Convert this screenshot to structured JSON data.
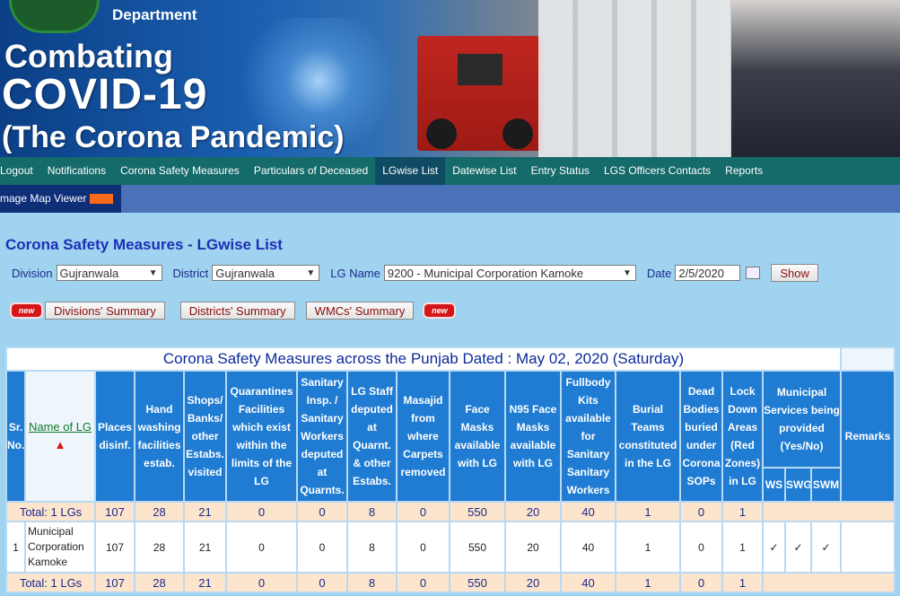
{
  "banner": {
    "department": "Department",
    "line1": "Combating",
    "line2": "COVID-19",
    "line3": "(The Corona Pandemic)"
  },
  "nav": {
    "items": [
      {
        "label": "Logout"
      },
      {
        "label": "Notifications"
      },
      {
        "label": "Corona Safety Measures"
      },
      {
        "label": "Particulars of Deceased"
      },
      {
        "label": "LGwise List"
      },
      {
        "label": "Datewise List"
      },
      {
        "label": "Entry Status"
      },
      {
        "label": "LGS Officers Contacts"
      },
      {
        "label": "Reports"
      }
    ],
    "active": "LGwise List",
    "sub_label": "mage Map Viewer"
  },
  "page": {
    "title": "Corona Safety Measures - LGwise List"
  },
  "filters": {
    "division_label": "Division",
    "division_value": "Gujranwala",
    "district_label": "District",
    "district_value": "Gujranwala",
    "lg_label": "LG Name",
    "lg_value": "9200 - Municipal Corporation Kamoke",
    "date_label": "Date",
    "date_value": "2/5/2020",
    "show_button": "Show"
  },
  "summaries": {
    "new_badge": "new",
    "divisions": "Divisions' Summary",
    "districts": "Districts' Summary",
    "wmcs": "WMCs' Summary"
  },
  "table": {
    "caption": "Corona Safety Measures across the Punjab Dated : May 02, 2020 (Saturday)",
    "headers": {
      "sr": "Sr. No.",
      "name": "Name of LG",
      "places": "Places disinf.",
      "hand": "Hand washing facilities estab.",
      "shops": "Shops/ Banks/ other Estabs. visited",
      "quarantine": "Quarantines Facilities which exist within the limits of the LG",
      "sanitary": "Sanitary Insp. / Sanitary Workers deputed at Quarnts.",
      "lgstaff": "LG Staff deputed at Quarnt. & other Estabs.",
      "masajid": "Masajid from where Carpets removed",
      "face": "Face Masks available with LG",
      "n95": "N95 Face Masks available with LG",
      "fullbody": "Fullbody Kits available for Sanitary Sanitary Workers",
      "burial": "Burial Teams constituted in the LG",
      "dead": "Dead Bodies buried under Corona SOPs",
      "lockdown": "Lock Down Areas (Red Zones) in LG",
      "municipal": "Municipal Services being provided (Yes/No)",
      "ws": "WS",
      "swg": "SWG",
      "swm": "SWM",
      "remarks": "Remarks"
    },
    "total_row": {
      "label": "Total: 1 LGs",
      "places": "107",
      "hand": "28",
      "shops": "21",
      "quarantine": "0",
      "sanitary": "0",
      "lgstaff": "8",
      "masajid": "0",
      "face": "550",
      "n95": "20",
      "fullbody": "40",
      "burial": "1",
      "dead": "0",
      "lockdown": "1"
    },
    "row": {
      "sr": "1",
      "name": "Municipal Corporation Kamoke",
      "places": "107",
      "hand": "28",
      "shops": "21",
      "quarantine": "0",
      "sanitary": "0",
      "lgstaff": "8",
      "masajid": "0",
      "face": "550",
      "n95": "20",
      "fullbody": "40",
      "burial": "1",
      "dead": "0",
      "lockdown": "1",
      "ws": "✓",
      "swg": "✓",
      "swm": "✓",
      "remarks": ""
    }
  }
}
